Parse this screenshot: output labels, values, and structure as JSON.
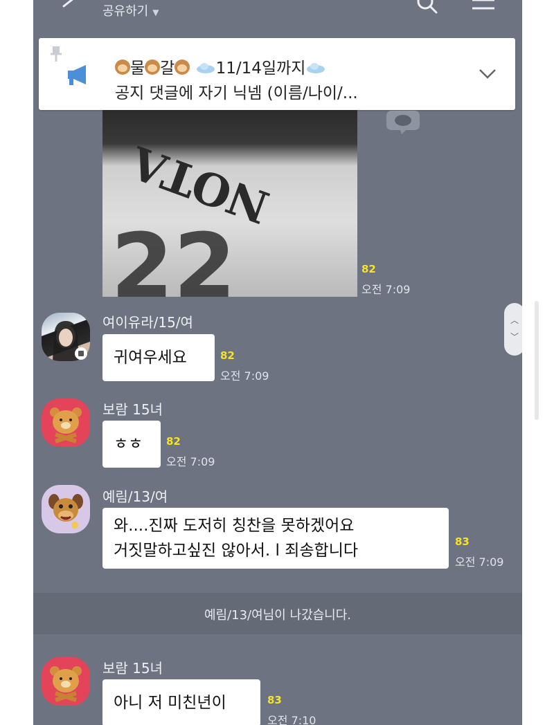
{
  "header": {
    "title": "공유하기",
    "caret": "▼"
  },
  "notice": {
    "line1_words": [
      "물",
      "갈",
      "11/14일까지"
    ],
    "line2": "공지 댓글에 자기 닉넴 (이름/나이/..."
  },
  "photo_message": {
    "unread": "82",
    "time": "오전 7:09"
  },
  "messages": [
    {
      "sender": "여이유라/15/여",
      "text": "귀여우세요",
      "unread": "82",
      "time": "오전 7:09"
    },
    {
      "sender": "보람 15녀",
      "text": "ㅎㅎ",
      "unread": "82",
      "time": "오전 7:09"
    },
    {
      "sender": "예림/13/여",
      "lines": [
        "와....진짜 도저히 칭찬을 못하겠어요",
        "거짓말하고싶진 않아서. l  죄송합니다"
      ],
      "unread": "83",
      "time": "오전 7:09"
    },
    {
      "sender": "보람 15녀",
      "text": "아니 저 미친년이",
      "unread": "83",
      "time": "오전 7:10"
    }
  ],
  "system_message": "예림/13/여님이 나갔습니다.",
  "colors": {
    "chat_bg": "#6d7380",
    "unread": "#f6e32a",
    "bubble": "#ffffff"
  }
}
